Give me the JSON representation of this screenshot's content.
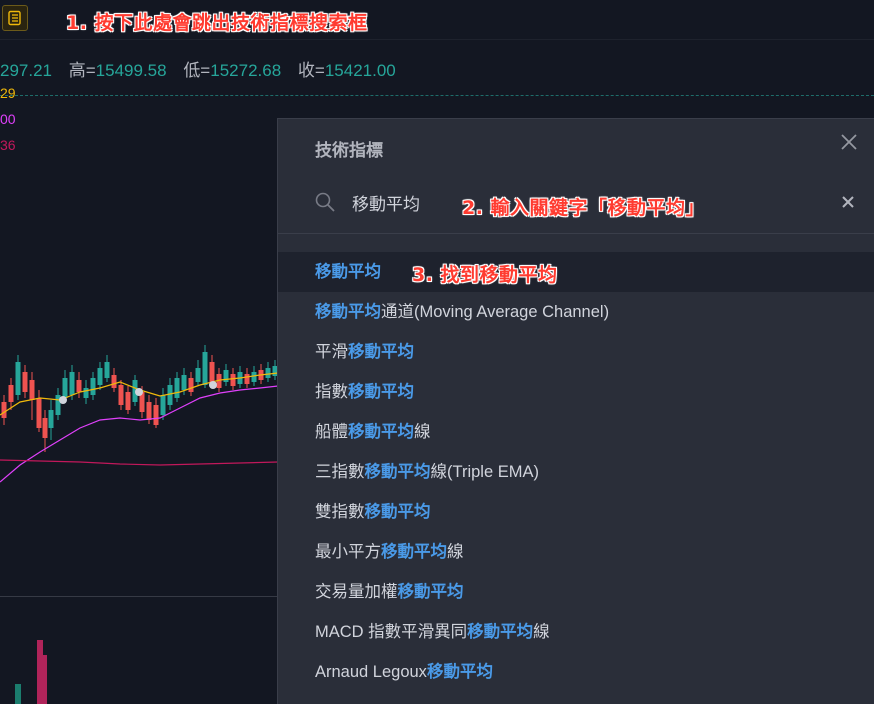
{
  "annotations": {
    "step1": "1. 按下此處會跳出技術指標搜索框",
    "step2": "2. 輸入關鍵字「移動平均」",
    "step3": "3. 找到移動平均"
  },
  "legend": {
    "open_partial": "297.21",
    "high_label": "高=",
    "high_value": "15499.58",
    "low_label": "低=",
    "low_value": "15272.68",
    "close_label": "收=",
    "close_value": "15421.00"
  },
  "ma_values": [
    "29",
    "00",
    "36"
  ],
  "colors": {
    "background": "#131722",
    "dialog_bg": "#2a2e39",
    "up": "#26a69a",
    "down": "#ef5350",
    "highlight": "#4a9ae8",
    "ma_fast": "#f0b90b",
    "ma_mid": "#e040fb",
    "ma_slow": "#c2185b",
    "annotation": "#ff3b30"
  },
  "icons": {
    "indicator_button": "indicator-list-icon",
    "search": "search-icon",
    "close": "close-icon",
    "clear": "clear-icon"
  },
  "dialog": {
    "title": "技術指標",
    "search_value": "移動平均",
    "results": [
      {
        "pre": "",
        "hl": "移動平均",
        "post": ""
      },
      {
        "pre": "",
        "hl": "移動平均",
        "post": "通道(Moving Average Channel)"
      },
      {
        "pre": "平滑",
        "hl": "移動平均",
        "post": ""
      },
      {
        "pre": "指數",
        "hl": "移動平均",
        "post": ""
      },
      {
        "pre": "船體",
        "hl": "移動平均",
        "post": "線"
      },
      {
        "pre": "三指數",
        "hl": "移動平均",
        "post": "線(Triple EMA)"
      },
      {
        "pre": "雙指數",
        "hl": "移動平均",
        "post": ""
      },
      {
        "pre": "最小平方",
        "hl": "移動平均",
        "post": "線"
      },
      {
        "pre": "交易量加權",
        "hl": "移動平均",
        "post": ""
      },
      {
        "pre": "MACD 指數平滑異同",
        "hl": "移動平均",
        "post": "線"
      },
      {
        "pre": "Arnaud Legoux",
        "hl": "移動平均",
        "post": ""
      }
    ]
  }
}
